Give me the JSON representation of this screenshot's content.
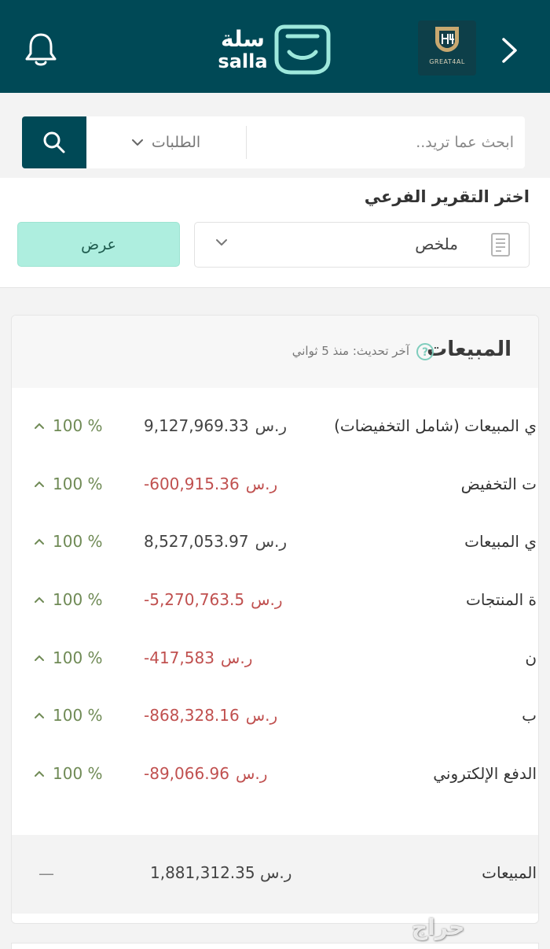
{
  "header": {
    "logo_ar": "سلة",
    "logo_en": "salla",
    "store_name": "GREAT4AL",
    "icons": [
      "bell-icon",
      "salla-bag-icon",
      "chevron-right-icon"
    ],
    "background": "#004956"
  },
  "search": {
    "placeholder": "ابحث عما تريد..",
    "scope_label": "الطلبات",
    "icons": [
      "search-icon",
      "chevron-down-icon"
    ]
  },
  "report": {
    "label": "اختر التقرير الفرعي",
    "selected": "ملخص",
    "view_button": "عرض",
    "icons": [
      "document-icon",
      "chevron-down-icon"
    ]
  },
  "sales": {
    "title": "المبيعات",
    "updated": "آخر تحديث: منذ 5 ثواني",
    "accent": "#6f8a55",
    "negative_color": "#c0504f",
    "rows": [
      {
        "label": "ي المبيعات (شامل التخفيضات)",
        "amount": "9,127,969.33",
        "currency": "ر.س",
        "pct": "100 %",
        "negative": false
      },
      {
        "label": "ت التخفيض",
        "amount": "-600,915.36",
        "currency": "ر.س",
        "pct": "100 %",
        "negative": true
      },
      {
        "label": "ي المبيعات",
        "amount": "8,527,053.97",
        "currency": "ر.س",
        "pct": "100 %",
        "negative": false
      },
      {
        "label": "ة المنتجات",
        "amount": "-5,270,763.5",
        "currency": "ر.س",
        "pct": "100 %",
        "negative": true
      },
      {
        "label": "ن",
        "amount": "-417,583",
        "currency": "ر.س",
        "pct": "100 %",
        "negative": true
      },
      {
        "label": "ب",
        "amount": "-868,328.16",
        "currency": "ر.س",
        "pct": "100 %",
        "negative": true
      },
      {
        "label": "الدفع الإلكتروني",
        "amount": "-89,066.96",
        "currency": "ر.س",
        "pct": "100 %",
        "negative": true
      }
    ],
    "total": {
      "label": "المبيعات",
      "amount": "1,881,312.35",
      "currency": "ر.س",
      "pct": "—"
    }
  },
  "watermark": "حراج"
}
